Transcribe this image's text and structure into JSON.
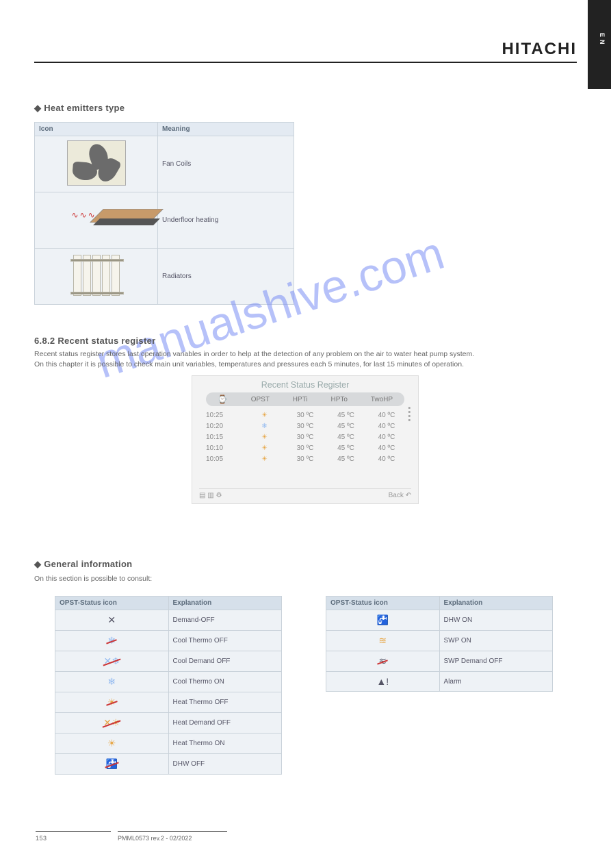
{
  "header": {
    "brand": "HITACHI",
    "margin_lang": "EN"
  },
  "sec1": {
    "title": "◆ Heat emitters type",
    "cols": {
      "icon": "Icon",
      "meaning": "Meaning"
    },
    "rows": [
      {
        "name": "fan-coils",
        "meaning": "Fan Coils"
      },
      {
        "name": "underfloor",
        "meaning": "Underfloor heating"
      },
      {
        "name": "radiators",
        "meaning": "Radiators"
      }
    ]
  },
  "sec2": {
    "title": "6.8.2 Recent status register",
    "body": "Recent status register stores last operation variables in order to help at the detection of any problem on the air to water heat pump system.\nOn this chapter it is possible to check main unit variables, temperatures and pressures each 5 minutes, for last 15 minutes of operation."
  },
  "register": {
    "title": "Recent Status Register",
    "cols": {
      "clock": "⌚",
      "opst": "OPST",
      "hpti": "HPTi",
      "hpto": "HPTo",
      "twohp": "TwoHP"
    },
    "rows": [
      {
        "time": "10:25",
        "opst": "☀",
        "hpti": "30 ºC",
        "hpto": "45 ºC",
        "twohp": "40 ºC"
      },
      {
        "time": "10:20",
        "opst": "❄",
        "hpti": "30 ºC",
        "hpto": "45 ºC",
        "twohp": "40 ºC"
      },
      {
        "time": "10:15",
        "opst": "☀",
        "hpti": "30 ºC",
        "hpto": "45 ºC",
        "twohp": "40 ºC"
      },
      {
        "time": "10:10",
        "opst": "☀",
        "hpti": "30 ºC",
        "hpto": "45 ºC",
        "twohp": "40 ºC"
      },
      {
        "time": "10:05",
        "opst": "☀",
        "hpti": "30 ºC",
        "hpto": "45 ºC",
        "twohp": "40 ºC"
      }
    ],
    "back": "Back ↶"
  },
  "sec3": {
    "title": "◆ General information",
    "body": "On this section is possible to consult:",
    "table1": {
      "cols": {
        "icon": "OPST-Status icon",
        "meaning": "Explanation"
      },
      "rows": [
        {
          "icon": "✕",
          "class": "",
          "meaning": "Demand-OFF"
        },
        {
          "icon": "❄",
          "class": "strike",
          "meaning": "Cool Thermo OFF"
        },
        {
          "icon": "✕❄",
          "class": "strike",
          "meaning": "Cool Demand OFF"
        },
        {
          "icon": "❄",
          "class": "flake",
          "meaning": "Cool Thermo ON"
        },
        {
          "icon": "☀",
          "class": "strike sun",
          "meaning": "Heat Thermo OFF"
        },
        {
          "icon": "✕☀",
          "class": "strike sun",
          "meaning": "Heat Demand OFF"
        },
        {
          "icon": "☀",
          "class": "sun",
          "meaning": "Heat Thermo ON"
        },
        {
          "icon": "🚰",
          "class": "strike",
          "meaning": "DHW OFF"
        }
      ]
    },
    "table2": {
      "cols": {
        "icon": "OPST-Status icon",
        "meaning": "Explanation"
      },
      "rows": [
        {
          "icon": "🚰",
          "class": "sun",
          "meaning": "DHW ON"
        },
        {
          "icon": "≋",
          "class": "sun",
          "meaning": "SWP ON"
        },
        {
          "icon": "≋",
          "class": "strike",
          "meaning": "SWP Demand OFF"
        },
        {
          "icon": "▲!",
          "class": "",
          "meaning": "Alarm"
        }
      ]
    }
  },
  "footer": {
    "pageno": "153",
    "doc": "PMML0573 rev.2 - 02/2022",
    "model": ""
  }
}
